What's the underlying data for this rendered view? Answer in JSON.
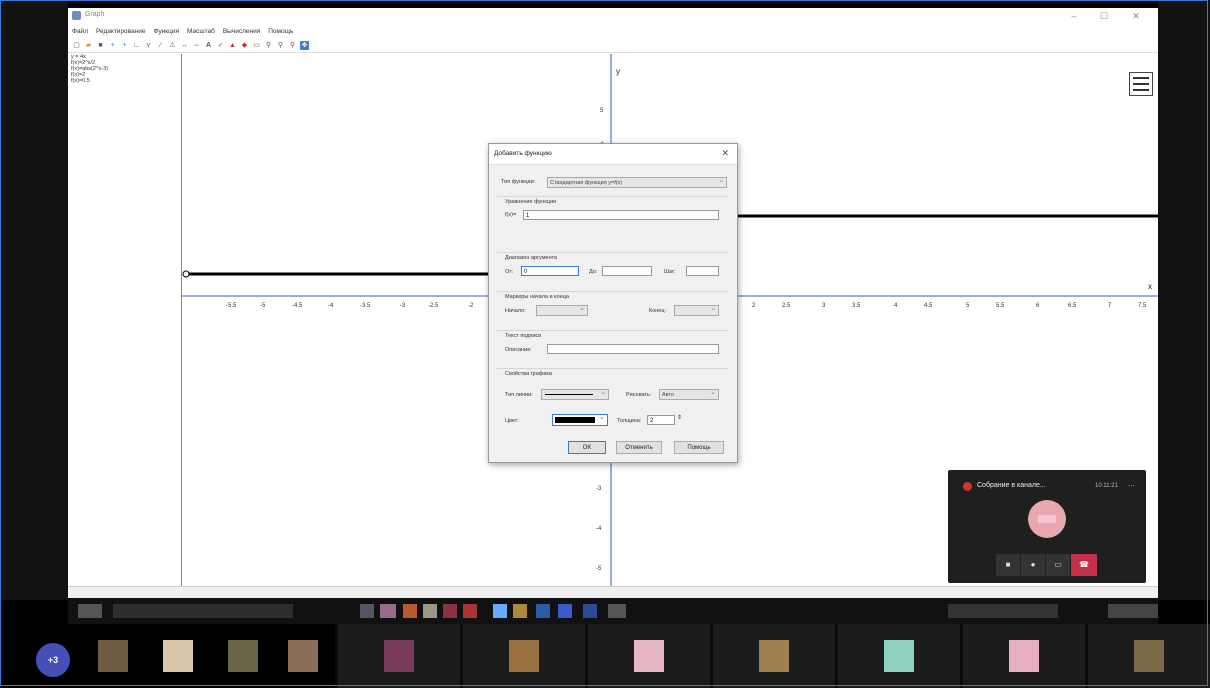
{
  "app": {
    "title": "Graph",
    "menu": [
      "Файл",
      "Редактирование",
      "Функция",
      "Масштаб",
      "Вычисления",
      "Помощь"
    ],
    "function_list": [
      "y = 4x",
      "f(x)=2^x/2",
      "f(x)=abs(2^x-3)",
      "f(x)=2",
      "f(x)=0.5"
    ]
  },
  "plot": {
    "axis_y_label": "y",
    "axis_x_label": "x",
    "x_ticks": [
      "-5.5",
      "-5",
      "-4.5",
      "-4",
      "-3.5",
      "-3",
      "-2.5",
      "-2",
      "2",
      "2.5",
      "3",
      "3.5",
      "4",
      "4.5",
      "5",
      "5.5",
      "6",
      "6.5",
      "7",
      "7.5"
    ],
    "y_ticks": [
      "5",
      "4",
      "-3",
      "-4",
      "-5"
    ]
  },
  "dialog": {
    "title": "Добавить функцию",
    "close": "✕",
    "type_label": "Тип функции:",
    "type_value": "Стандартная функция  y=f(x)",
    "equation_group": "Уравнение функции",
    "equation_label": "f(x)=",
    "equation_value": "1",
    "range_group": "Диапазон аргумента",
    "from_label": "От:",
    "from_value": "0",
    "to_label": "До:",
    "to_value": "",
    "step_label": "Шаг:",
    "step_value": "",
    "markers_group": "Маркеры начала и конца",
    "start_label": "Начало:",
    "end_label": "Конец:",
    "legend_group": "Текст подписи",
    "desc_label": "Описание:",
    "desc_value": "",
    "props_group": "Свойства графика",
    "line_type_label": "Тип линии:",
    "draw_label": "Рисовать:",
    "draw_value": "Авто",
    "color_label": "Цвет:",
    "color_value": "#000000",
    "width_label": "Толщина:",
    "width_value": "2",
    "ok": "OK",
    "cancel": "Отменить",
    "help": "Помощь"
  },
  "call": {
    "title": "Собрание в канале...",
    "time": "10:11:21",
    "more": "...",
    "extra_participants": "+3"
  },
  "colors": {
    "accent": "#3a7bd5",
    "hangup": "#c4314b",
    "record": "#d13438",
    "teams": "#464eb8"
  }
}
